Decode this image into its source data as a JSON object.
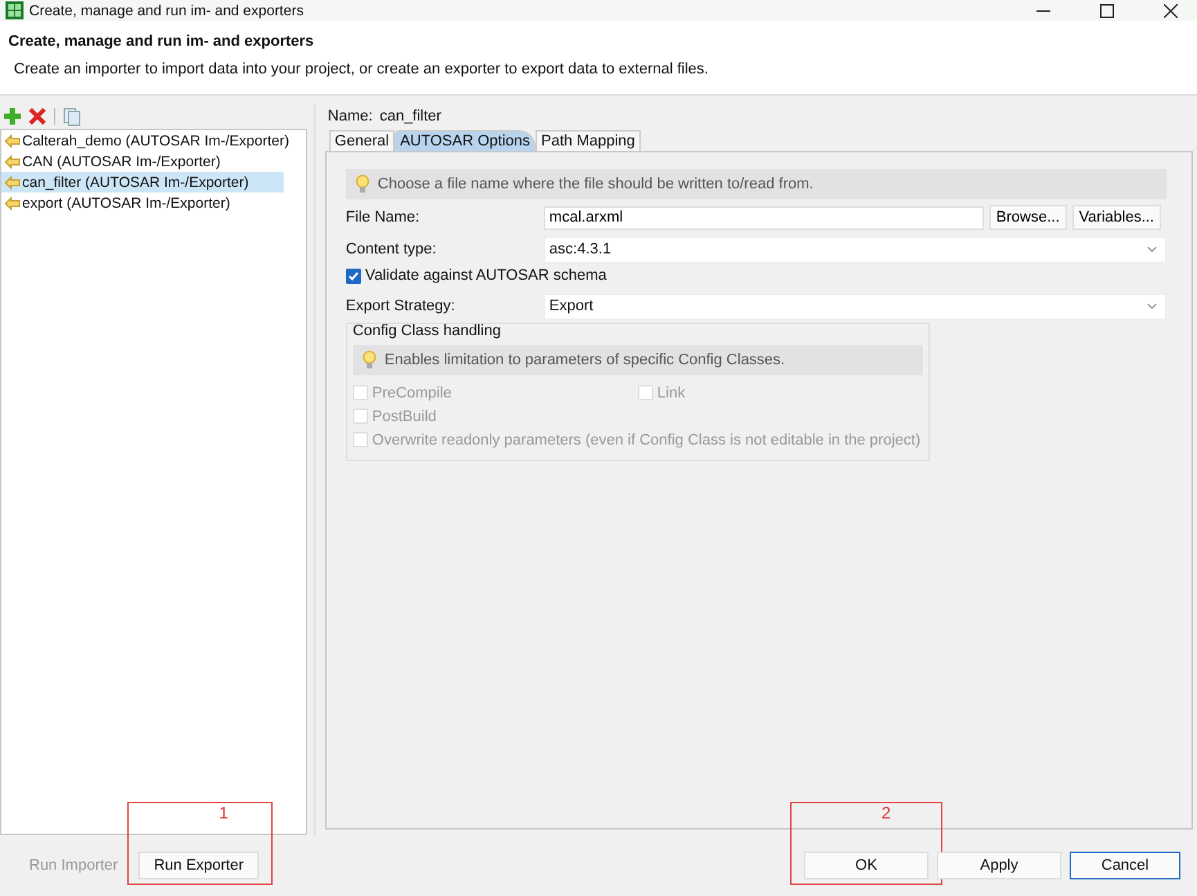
{
  "window": {
    "title": "Create, manage and run im- and exporters"
  },
  "header": {
    "title": "Create, manage and run im- and exporters",
    "description": "Create an importer to import data into your project, or create an exporter to export data to external files."
  },
  "list": [
    {
      "label": "Calterah_demo (AUTOSAR Im-/Exporter)",
      "selected": false
    },
    {
      "label": "CAN (AUTOSAR Im-/Exporter)",
      "selected": false
    },
    {
      "label": "can_filter (AUTOSAR Im-/Exporter)",
      "selected": true
    },
    {
      "label": "export (AUTOSAR Im-/Exporter)",
      "selected": false
    }
  ],
  "name": {
    "label": "Name:",
    "value": "can_filter"
  },
  "tabs": [
    {
      "label": "General",
      "selected": false
    },
    {
      "label": "AUTOSAR Options",
      "selected": true
    },
    {
      "label": "Path Mapping",
      "selected": false
    }
  ],
  "hint": "Choose a file name where the file should be written to/read from.",
  "file_name": {
    "label": "File Name:",
    "value": "mcal.arxml",
    "buttons": [
      "Browse...",
      "Variables..."
    ]
  },
  "content_type": {
    "label": "Content type:",
    "value": "asc:4.3.1"
  },
  "validate": {
    "label": "Validate against AUTOSAR schema",
    "checked": true
  },
  "export_strategy": {
    "label": "Export Strategy:",
    "value": "Export"
  },
  "config_class": {
    "title": "Config Class handling",
    "hint": "Enables limitation to parameters of specific Config Classes.",
    "options": [
      {
        "label": "PreCompile",
        "checked": false,
        "disabled": true
      },
      {
        "label": "Link",
        "checked": false,
        "disabled": true
      },
      {
        "label": "PostBuild",
        "checked": false,
        "disabled": true
      },
      {
        "label": "Overwrite readonly parameters (even if Config Class is not editable in the project)",
        "checked": false,
        "disabled": true
      }
    ]
  },
  "left_buttons": [
    {
      "label": "Run Importer",
      "disabled": true
    },
    {
      "label": "Run Exporter",
      "disabled": false,
      "annotation": "1"
    }
  ],
  "right_buttons": [
    {
      "label": "OK",
      "disabled": false,
      "annotation": "2"
    },
    {
      "label": "Apply",
      "disabled": false
    },
    {
      "label": "Cancel",
      "disabled": false
    }
  ]
}
